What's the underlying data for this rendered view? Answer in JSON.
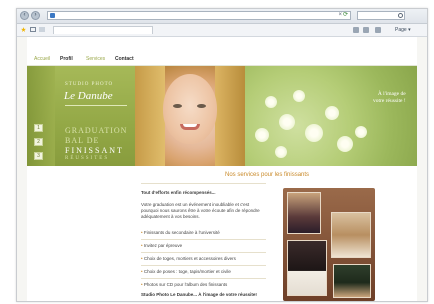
{
  "menu": {
    "item1": "Accueil",
    "item2": "Profil",
    "item3": "Services",
    "item4": "Contact"
  },
  "banner": {
    "studio_sub": "STUDIO PHOTO",
    "logo": "Le Danube",
    "buttons": [
      "1",
      "2",
      "3"
    ],
    "word1": "GRADUATION",
    "word2": "BAL DE",
    "word3": "FINISSANT",
    "word4": "RÉUSSITES",
    "tagline_line1": "À l'image de",
    "tagline_line2": "votre réussite !"
  },
  "content": {
    "title": "Nos services pour les finissants",
    "intro": "Tout d'efforts enfin récompensés...",
    "para": "Votre graduation est un événement inoubliable et c'est pourquoi nous saurons être à votre écoute afin de répondre adéquatement à vos besoins.",
    "bullets": [
      "Finissants du secondaire à l'université",
      "Invitez par épreuve",
      "Choix de toges, mortiers et accessoires divers",
      "Choix de poses : toge, tapis/mortier et civile",
      "Photos sur CD pour l'album des finissants"
    ],
    "closing": "Studio Photo Le Danube... À l'image de votre réussite!"
  },
  "colors": {
    "accent": "#c98a2a",
    "banner_green": "#93a846",
    "gallery_brown": "#7a4a30"
  }
}
